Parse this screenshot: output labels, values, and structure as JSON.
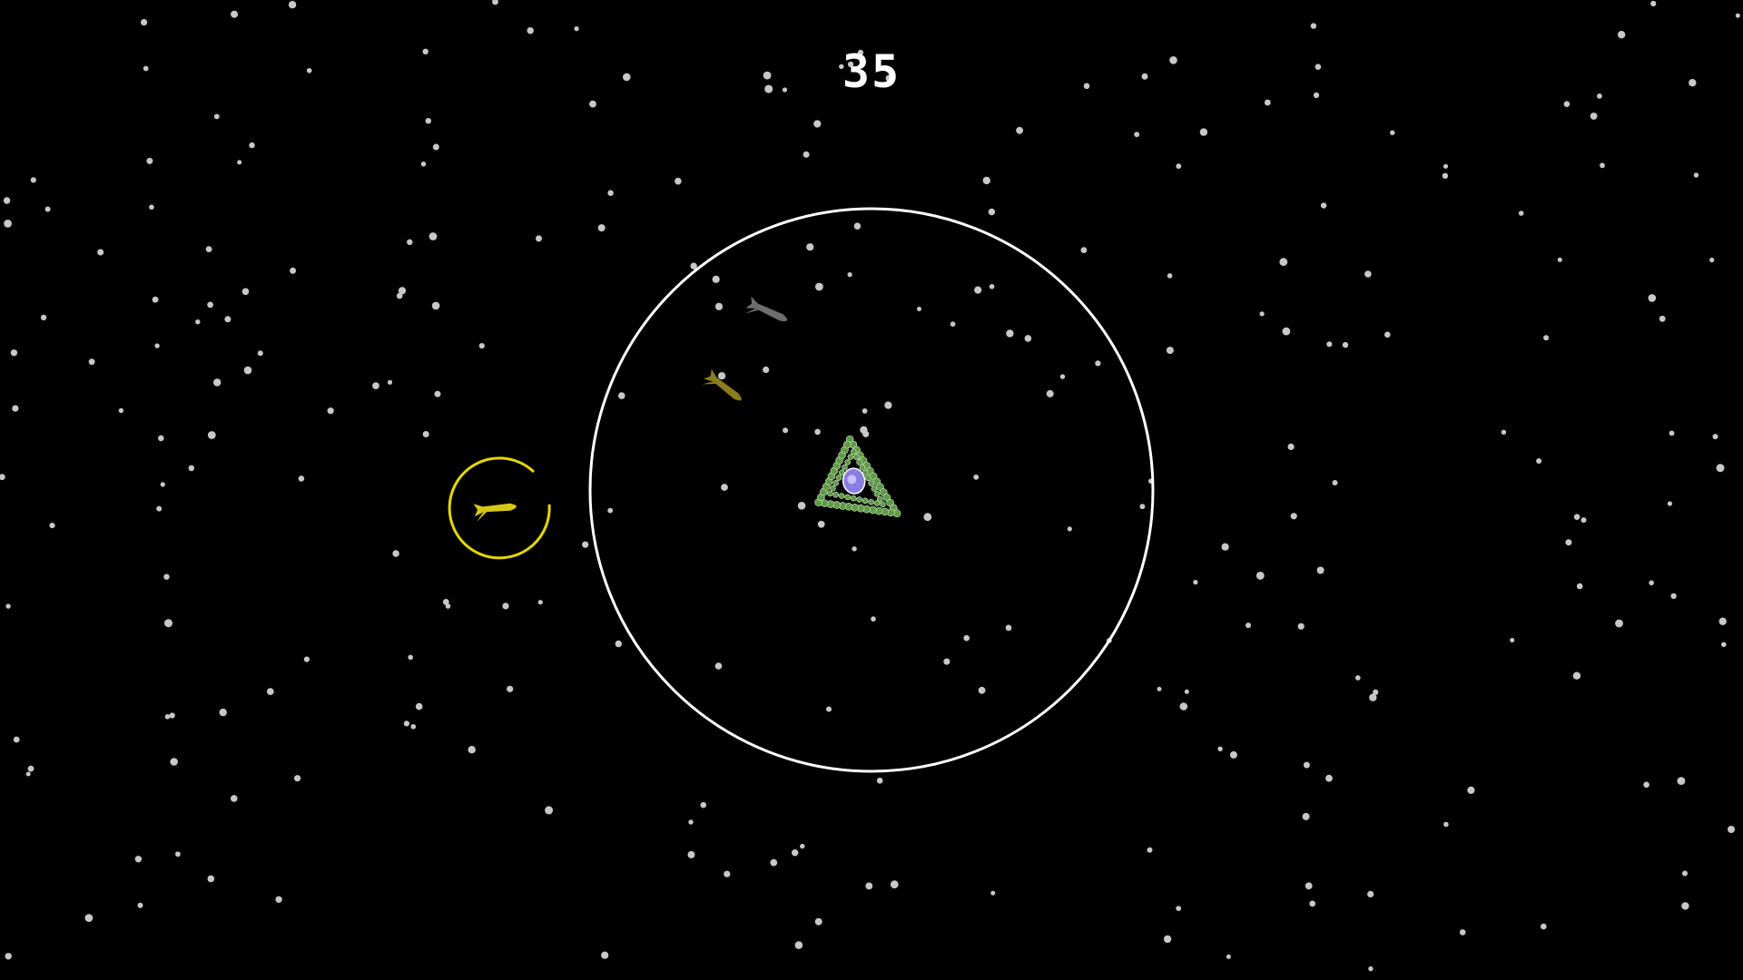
{
  "hud": {
    "score": "35"
  },
  "colors": {
    "background": "#000000",
    "star": "#c8c8c8",
    "score_text": "#ffffff",
    "orbit_ring": "#ffffff",
    "target_ring": "#e5d600",
    "missile_active": "#d6c618",
    "missile_olive": "#8a7d1e",
    "missile_gray": "#6e6e6e",
    "ship_hull": "#5f9a48",
    "ship_core": "#8a7fe0"
  },
  "icons": {
    "player_ship": "triangle-ship-icon",
    "missile": "missile-icon",
    "target_marker": "target-ring-icon"
  }
}
